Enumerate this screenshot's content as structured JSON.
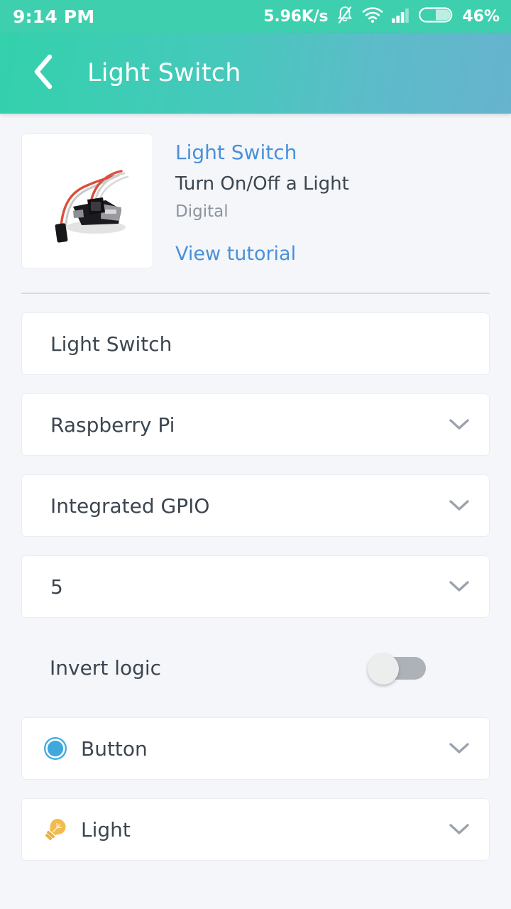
{
  "status_bar": {
    "time": "9:14 PM",
    "network_speed": "5.96K/s",
    "battery_percent": "46%",
    "icons": [
      "notifications-muted-icon",
      "wifi-icon",
      "cellular-signal-icon",
      "battery-icon"
    ],
    "background_color": "#3ed0ae"
  },
  "header": {
    "back_icon": "chevron-left-icon",
    "title": "Light Switch",
    "gradient_from": "#33d1ac",
    "gradient_to": "#66b3ce"
  },
  "product": {
    "image_alt": "usb-relay-switch-module-photo",
    "name": "Light Switch",
    "description": "Turn On/Off a Light",
    "signal_type": "Digital",
    "tutorial_link": "View tutorial",
    "link_color": "#4a90d9"
  },
  "form": {
    "fields": [
      {
        "name_key": "device-name",
        "value": "Light Switch",
        "has_chevron": false,
        "icon": null
      },
      {
        "name_key": "board",
        "value": "Raspberry Pi",
        "has_chevron": true,
        "icon": null
      },
      {
        "name_key": "connection",
        "value": "Integrated GPIO",
        "has_chevron": true,
        "icon": null
      },
      {
        "name_key": "pin",
        "value": "5",
        "has_chevron": true,
        "icon": null
      }
    ],
    "invert_logic": {
      "label": "Invert logic",
      "enabled": false
    },
    "icon_fields": [
      {
        "name_key": "control-type",
        "value": "Button",
        "icon": "button-circle-icon",
        "icon_color": "#3fa9dd",
        "has_chevron": true
      },
      {
        "name_key": "display-icon",
        "value": "Light",
        "icon": "lightbulb-icon",
        "icon_color": "#f2bb4e",
        "has_chevron": true
      }
    ]
  }
}
